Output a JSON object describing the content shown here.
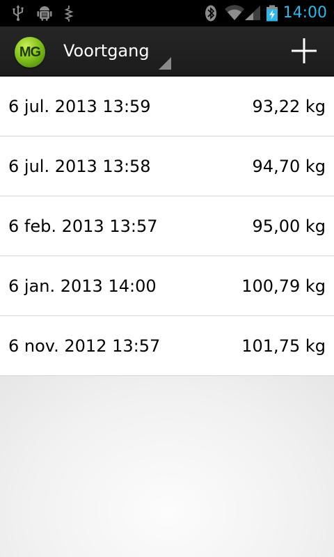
{
  "status_bar": {
    "time": "14:00",
    "icons": [
      "usb-icon",
      "android-debug-icon",
      "debug-icon",
      "bluetooth-icon",
      "wifi-icon",
      "signal-icon",
      "battery-charging-icon"
    ],
    "clock_color": "#33b5e5"
  },
  "action_bar": {
    "logo_text": "MG",
    "title": "Voortgang",
    "add_icon": "plus-icon",
    "logo_color": "#86c21f"
  },
  "entries": [
    {
      "date": "6 jul. 2013 13:59",
      "weight": "93,22 kg"
    },
    {
      "date": "6 jul. 2013 13:58",
      "weight": "94,70 kg"
    },
    {
      "date": "6 feb. 2013 13:57",
      "weight": "95,00 kg"
    },
    {
      "date": "6 jan. 2013 14:00",
      "weight": "100,79 kg"
    },
    {
      "date": "6 nov. 2012 13:57",
      "weight": "101,75 kg"
    }
  ]
}
